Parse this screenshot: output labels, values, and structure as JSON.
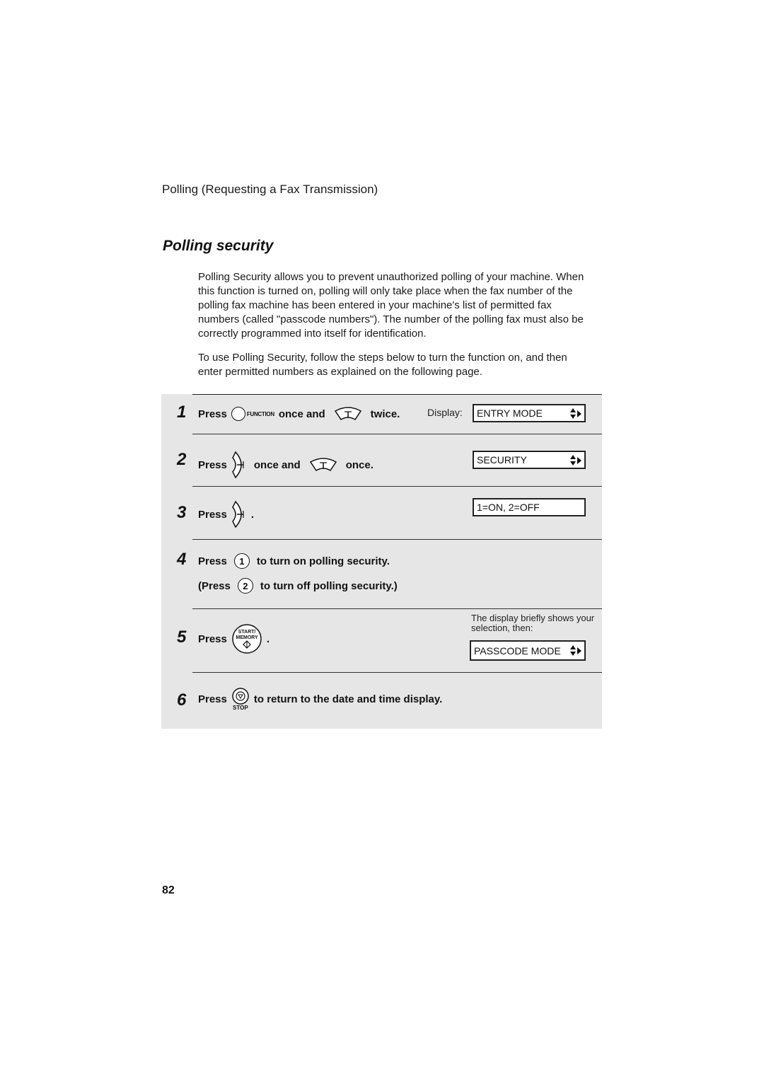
{
  "header": {
    "section_title": "Polling (Requesting a Fax Transmission)"
  },
  "title": "Polling security",
  "intro": {
    "paragraphs": [
      "Polling Security allows you to prevent unauthorized polling of your machine. When this function is turned on, polling will only take place when the fax number of the polling fax machine has been entered in your machine's list of permitted fax numbers (called \"passcode numbers\"). The number of the polling fax must also be correctly programmed into itself for identification.",
      "To use Polling Security, follow the steps below to turn the function on, and then enter permitted numbers as explained on the following page."
    ]
  },
  "steps": [
    {
      "number": "1",
      "press": "Press",
      "key1_label": "FUNCTION",
      "mid": "once and",
      "end": "twice.",
      "display_label": "Display:",
      "display": "ENTRY MODE"
    },
    {
      "number": "2",
      "press": "Press",
      "mid": "once and",
      "end": "once.",
      "display": "SECURITY"
    },
    {
      "number": "3",
      "press": "Press",
      "end": ".",
      "display": "1=ON, 2=OFF"
    },
    {
      "number": "4",
      "press": "Press",
      "key1": "1",
      "text1": "to turn on polling security.",
      "press2": "(Press",
      "key2": "2",
      "text2": "to turn off polling security.)"
    },
    {
      "number": "5",
      "press": "Press",
      "key_top": "START/",
      "key_bottom": "MEMORY",
      "end": ".",
      "note": "The display briefly shows your selection, then:",
      "display": "PASSCODE MODE"
    },
    {
      "number": "6",
      "press": "Press",
      "key_label": "STOP",
      "text": "to return to the date and time display."
    }
  ],
  "icons": {
    "function_key": "function-key-icon",
    "down_arrow_key": "down-arrow-key-icon",
    "right_arrow_key": "right-arrow-key-icon",
    "start_memory_key": "start-memory-key-icon",
    "stop_key": "stop-key-icon",
    "updown_right_arrows": "scroll-arrows-icon"
  },
  "page_number": "82"
}
